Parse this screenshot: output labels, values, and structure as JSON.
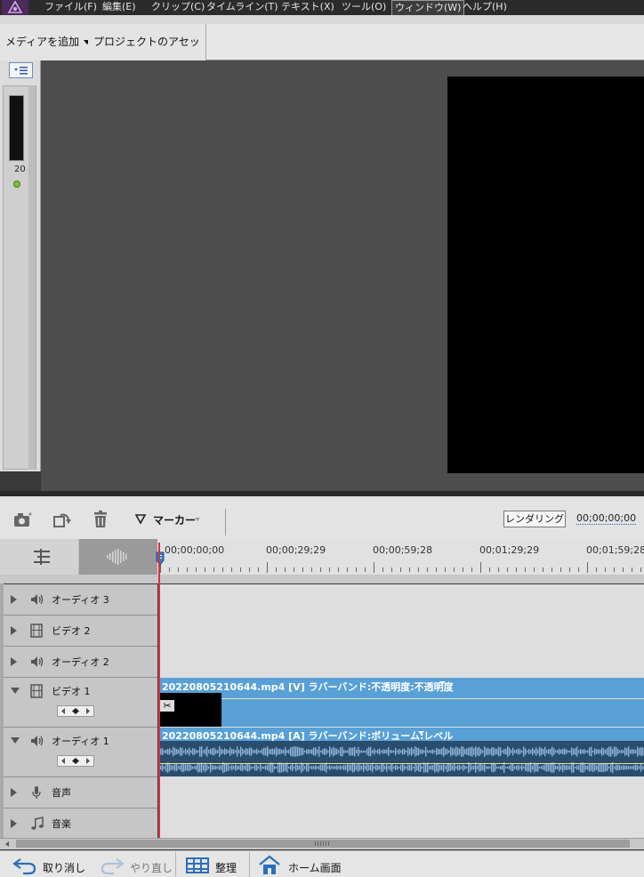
{
  "menu": {
    "items": [
      "ファイル(F)",
      "編集(E)",
      "クリップ(C)",
      "タイムライン(T)",
      "テキスト(X)",
      "ツール(O)",
      "ウィンドウ(W)",
      "ヘルプ(H)"
    ],
    "active": "ウィンドウ(W)"
  },
  "toolbar": {
    "add_media": "メディアを追加",
    "project_assets": "プロジェクトのアセット"
  },
  "media_panel": {
    "item_label": "20"
  },
  "timeline_toolbar": {
    "marker_label": "マーカー",
    "render_label": "レンダリング",
    "timecode": "00;00;00;00"
  },
  "ruler": {
    "timecodes": [
      "00;00;00;00",
      "00;00;29;29",
      "00;00;59;28",
      "00;01;29;29",
      "00;01;59;28"
    ]
  },
  "tracks": [
    {
      "name": "オーディオ 3",
      "kind": "audio",
      "expanded": false
    },
    {
      "name": "ビデオ 2",
      "kind": "video",
      "expanded": false
    },
    {
      "name": "オーディオ 2",
      "kind": "audio",
      "expanded": false
    },
    {
      "name": "ビデオ 1",
      "kind": "video",
      "expanded": true
    },
    {
      "name": "オーディオ 1",
      "kind": "audio",
      "expanded": true
    },
    {
      "name": "音声",
      "kind": "mic",
      "expanded": false
    },
    {
      "name": "音楽",
      "kind": "music",
      "expanded": false
    }
  ],
  "clips": {
    "video": "20220805210644.mp4 [V] ラバーバンド:不透明度:不透明度",
    "audio": "20220805210644.mp4 [A] ラバーバンド:ボリューム:レベル"
  },
  "bottom_bar": {
    "undo": "取り消し",
    "redo": "やり直し",
    "organize": "整理",
    "home": "ホーム画面"
  },
  "colors": {
    "playhead": "#e0303a",
    "clip": "#58a0d6",
    "audio_wave": "#2b4d6d"
  }
}
